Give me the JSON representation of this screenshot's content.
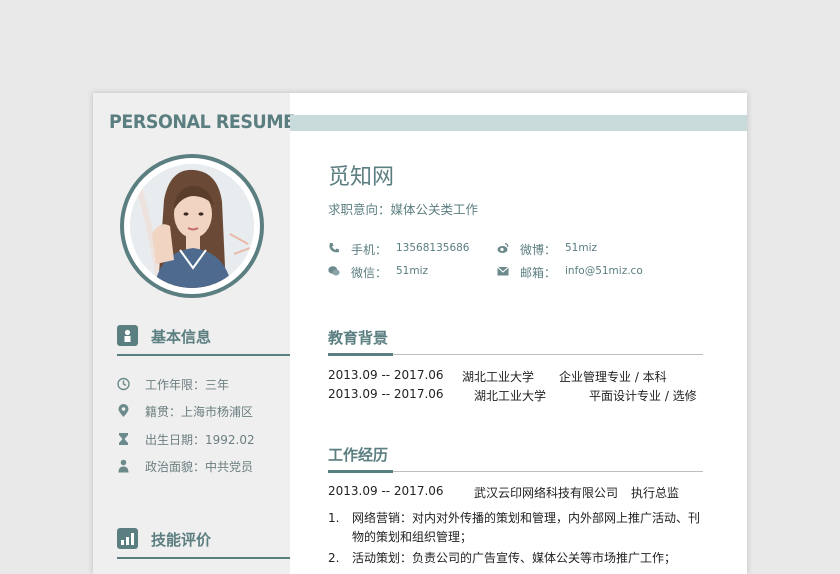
{
  "brand": "PERSONAL RESUME",
  "profile": {
    "name": "觅知网",
    "intent": "求职意向：媒体公关类工作"
  },
  "contacts": [
    {
      "icon": "phone-icon",
      "label": "手机：",
      "value": "13568135686"
    },
    {
      "icon": "weibo-icon",
      "label": "微博：",
      "value": "51miz"
    },
    {
      "icon": "wechat-icon",
      "label": "微信：",
      "value": "51miz"
    },
    {
      "icon": "mail-icon",
      "label": "邮箱：",
      "value": "info@51miz.co"
    }
  ],
  "basic": {
    "title": "基本信息",
    "items": [
      {
        "icon": "briefcase-icon",
        "text": "工作年限：三年"
      },
      {
        "icon": "location-pin-icon",
        "text": "籍贯：上海市杨浦区"
      },
      {
        "icon": "hourglass-icon",
        "text": "出生日期：1992.02"
      },
      {
        "icon": "person-icon",
        "text": "政治面貌：中共党员"
      }
    ]
  },
  "skills": {
    "title": "技能评价"
  },
  "education": {
    "title": "教育背景",
    "rows": [
      {
        "period": "2013.09 -- 2017.06",
        "school": "湖北工业大学",
        "major": "企业管理专业 / 本科"
      },
      {
        "period": "2013.09 -- 2017.06",
        "school": "湖北工业大学",
        "major": "平面设计专业 / 选修"
      }
    ]
  },
  "work": {
    "title": "工作经历",
    "period": "2013.09 -- 2017.06",
    "company": "武汉云印网络科技有限公司",
    "role": "执行总监",
    "duties": [
      {
        "num": "1.",
        "text": "网络营销：对内对外传播的策划和管理，内外部网上推广活动、刊物的策划和组织管理；"
      },
      {
        "num": "2.",
        "text": "活动策划：负责公司的广告宣传、媒体公关等市场推广工作；"
      }
    ]
  },
  "watermark": "觅知网",
  "colors": {
    "accent": "#5b7e80",
    "band": "#c8dad9",
    "sidebar": "#efefef"
  }
}
